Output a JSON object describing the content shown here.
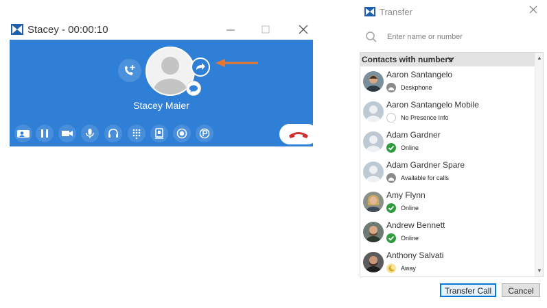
{
  "call_window": {
    "title": "Stacey - 00:00:10",
    "callee_name": "Stacey Maier",
    "toolbar": [
      {
        "name": "contact-card-icon"
      },
      {
        "name": "pause-icon"
      },
      {
        "name": "video-icon"
      },
      {
        "name": "microphone-icon"
      },
      {
        "name": "headset-icon"
      },
      {
        "name": "dialpad-icon"
      },
      {
        "name": "handset-icon"
      },
      {
        "name": "record-icon"
      },
      {
        "name": "park-icon"
      }
    ],
    "colors": {
      "body": "#2f7fd6",
      "hangup": "#d0312d"
    }
  },
  "transfer": {
    "title": "Transfer",
    "search": {
      "placeholder": "Enter name or number",
      "value": ""
    },
    "group_label": "Contacts with numbers",
    "contacts": [
      {
        "name": "Aaron Santangelo",
        "status": "Deskphone",
        "status_icon": "deskphone-icon",
        "photo": true
      },
      {
        "name": "Aaron Santangelo Mobile",
        "status": "No Presence Info",
        "status_icon": "no-presence-icon",
        "photo": false
      },
      {
        "name": "Adam Gardner",
        "status": "Online",
        "status_icon": "online-check-icon",
        "photo": false
      },
      {
        "name": "Adam Gardner Spare",
        "status": "Available for calls",
        "status_icon": "deskphone-icon",
        "photo": false
      },
      {
        "name": "Amy Flynn",
        "status": "Online",
        "status_icon": "online-check-icon",
        "photo": true
      },
      {
        "name": "Andrew Bennett",
        "status": "Online",
        "status_icon": "online-check-icon",
        "photo": true
      },
      {
        "name": "Anthony Salvati",
        "status": "Away",
        "status_icon": "away-moon-icon",
        "photo": true
      }
    ],
    "buttons": {
      "transfer": "Transfer Call",
      "cancel": "Cancel"
    },
    "colors": {
      "online": "#2e9b3e",
      "away": "#f2c94c",
      "accent_arrow": "#e8772e"
    }
  }
}
